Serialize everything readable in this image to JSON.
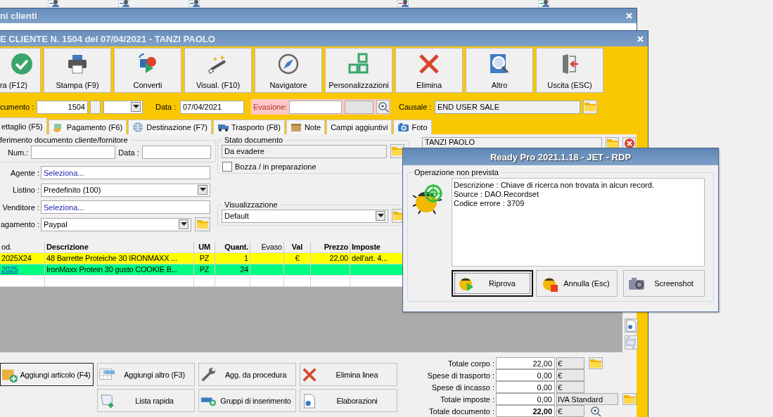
{
  "back_window": {
    "title": "ni clienti"
  },
  "document_window": {
    "title": "E CLIENTE N. 1504 del 07/04/2021 - TANZI PAOLO",
    "toolbar": [
      {
        "label": "ra (F12)"
      },
      {
        "label": "Stampa (F9)"
      },
      {
        "label": "Converti"
      },
      {
        "label": "Visual. (F10)"
      },
      {
        "label": "Navigatore"
      },
      {
        "label": "Personalizzazioni"
      },
      {
        "label": "Elimina"
      },
      {
        "label": "Altro"
      },
      {
        "label": "Uscita (ESC)"
      }
    ],
    "header": {
      "number": {
        "label": "cumento :",
        "value": "1504"
      },
      "date": {
        "label": "Data :",
        "value": "07/04/2021"
      },
      "evasione": {
        "label": "Evasione:"
      },
      "causale": {
        "label": "Causale :",
        "value": "END USER SALE"
      }
    },
    "tabs": [
      {
        "label": "ettaglio (F5)",
        "selected": true
      },
      {
        "label": "Pagamento (F6)",
        "selected": false
      },
      {
        "label": "Destinazione (F7)",
        "selected": false
      },
      {
        "label": "Trasporto (F8)",
        "selected": false
      },
      {
        "label": "Note",
        "selected": false
      },
      {
        "label": "Campi aggiuntivi",
        "selected": false
      },
      {
        "label": "Foto",
        "selected": false
      }
    ],
    "reference_group": {
      "title": "ferimento documento cliente/fornitore",
      "number_label": "Num.:",
      "date_label": "Data :"
    },
    "fields": [
      {
        "label": "Agente :",
        "value": "Seleziona...",
        "kind": "picker"
      },
      {
        "label": "Listino :",
        "value": "Predefinito (100)",
        "kind": "dropdown"
      },
      {
        "label": "Venditore :",
        "value": "Seleziona...",
        "kind": "picker"
      },
      {
        "label": "agamento :",
        "value": "Paypal",
        "kind": "dropdown-folder"
      }
    ],
    "status_group": {
      "title": "Stato documento",
      "value": "Da evadere",
      "draft": {
        "label": "Bozza / in preparazione",
        "checked": false
      }
    },
    "view_group": {
      "title": "Visualizzazione",
      "value": "Default"
    },
    "customer": {
      "value": "TANZI PAOLO"
    },
    "table": {
      "columns": [
        {
          "label": "od.",
          "bold": false
        },
        {
          "label": "Descrizione",
          "bold": true
        },
        {
          "label": "UM",
          "bold": true
        },
        {
          "label": "Quant.",
          "bold": true
        },
        {
          "label": "Evaso",
          "bold": false
        },
        {
          "label": "Val",
          "bold": true
        },
        {
          "label": "Prezzo",
          "bold": true
        },
        {
          "label": "Imposte",
          "bold": true
        }
      ],
      "rows": [
        {
          "code": "2025X24",
          "link": false,
          "description": "48 Barrette Proteiche 30 IRONMAXX ...",
          "um": "PZ",
          "quantity": "1",
          "currency": "€",
          "price": "22,00",
          "taxes": "dell'art. 4...",
          "color": "#ffff00"
        },
        {
          "code": "2025",
          "link": true,
          "description": "IronMaxx Protein 30 gusto COOKIE B...",
          "um": "PZ",
          "quantity": "24",
          "color": "#00ff80"
        }
      ]
    },
    "action_buttons": [
      {
        "label": "Aggiungi articolo (F4)",
        "focused": true
      },
      {
        "label": "Aggiungi altro (F3)",
        "focused": false
      },
      {
        "label": "Agg. da procedura",
        "focused": false
      },
      {
        "label": "Elimina linea",
        "focused": false
      },
      {
        "label": "Lista rapida",
        "focused": false
      },
      {
        "label": "Gruppi di inserimento",
        "focused": false
      },
      {
        "label": "Elaborazioni",
        "focused": false
      }
    ],
    "totals": [
      {
        "label": "Totale corpo :",
        "value": "22,00",
        "unit": "€",
        "kind": "folder",
        "bold": false
      },
      {
        "label": "Spese di trasporto :",
        "value": "0,00",
        "unit": "€",
        "bold": false
      },
      {
        "label": "Spese di incasso :",
        "value": "0,00",
        "unit": "€",
        "bold": false
      },
      {
        "label": "Totale imposte :",
        "value": "0,00",
        "unit": "IVA Standard",
        "kind": "folder",
        "bold": false
      },
      {
        "label": "Totale documento :",
        "value": "22,00",
        "unit": "€",
        "kind": "zoom",
        "bold": true
      }
    ]
  },
  "error_dialog": {
    "title": "Ready Pro 2021.1.18 - JET - RDP",
    "group": "Operazione non prevista",
    "message_lines": [
      "Descrizione : Chiave di ricerca non trovata in alcun record.",
      "Source : DAO.Recordset",
      "Codice errore : 3709"
    ],
    "buttons": [
      {
        "label": "Riprova",
        "focused": true
      },
      {
        "label": "Annulla (Esc)",
        "focused": false
      },
      {
        "label": "Screenshot",
        "focused": false
      }
    ]
  }
}
